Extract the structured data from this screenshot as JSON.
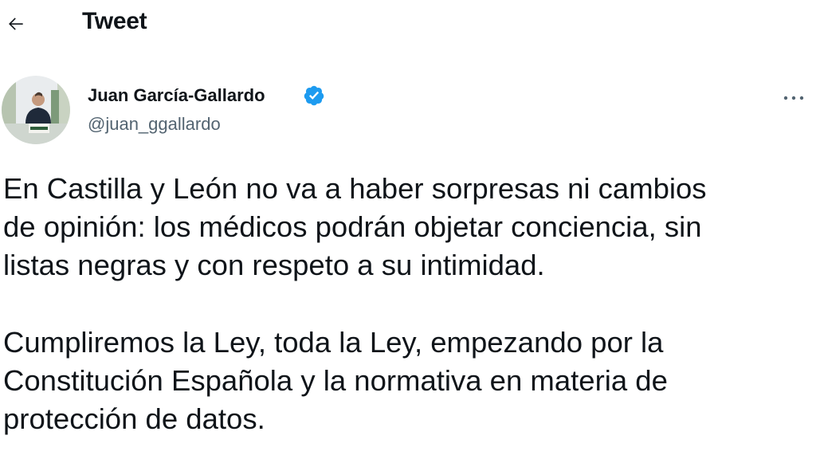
{
  "header": {
    "title": "Tweet",
    "back_icon": "arrow-left-icon"
  },
  "author": {
    "name": "Juan García-Gallardo",
    "handle": "@juan_ggallardo",
    "verified": true,
    "verified_color": "#1d9bf0",
    "avatar_icon": "profile-photo"
  },
  "menu": {
    "more_icon": "more-horizontal-icon"
  },
  "tweet": {
    "paragraphs": [
      {
        "lines": [
          "En Castilla y León no va a haber sorpresas ni cambios",
          "de opinión: los médicos podrán objetar conciencia, sin",
          "listas negras y con respeto a su intimidad."
        ]
      },
      {
        "lines": [
          "Cumpliremos la Ley, toda la Ley, empezando por la",
          "Constitución Española y la normativa en materia de",
          "protección de datos."
        ]
      }
    ]
  }
}
